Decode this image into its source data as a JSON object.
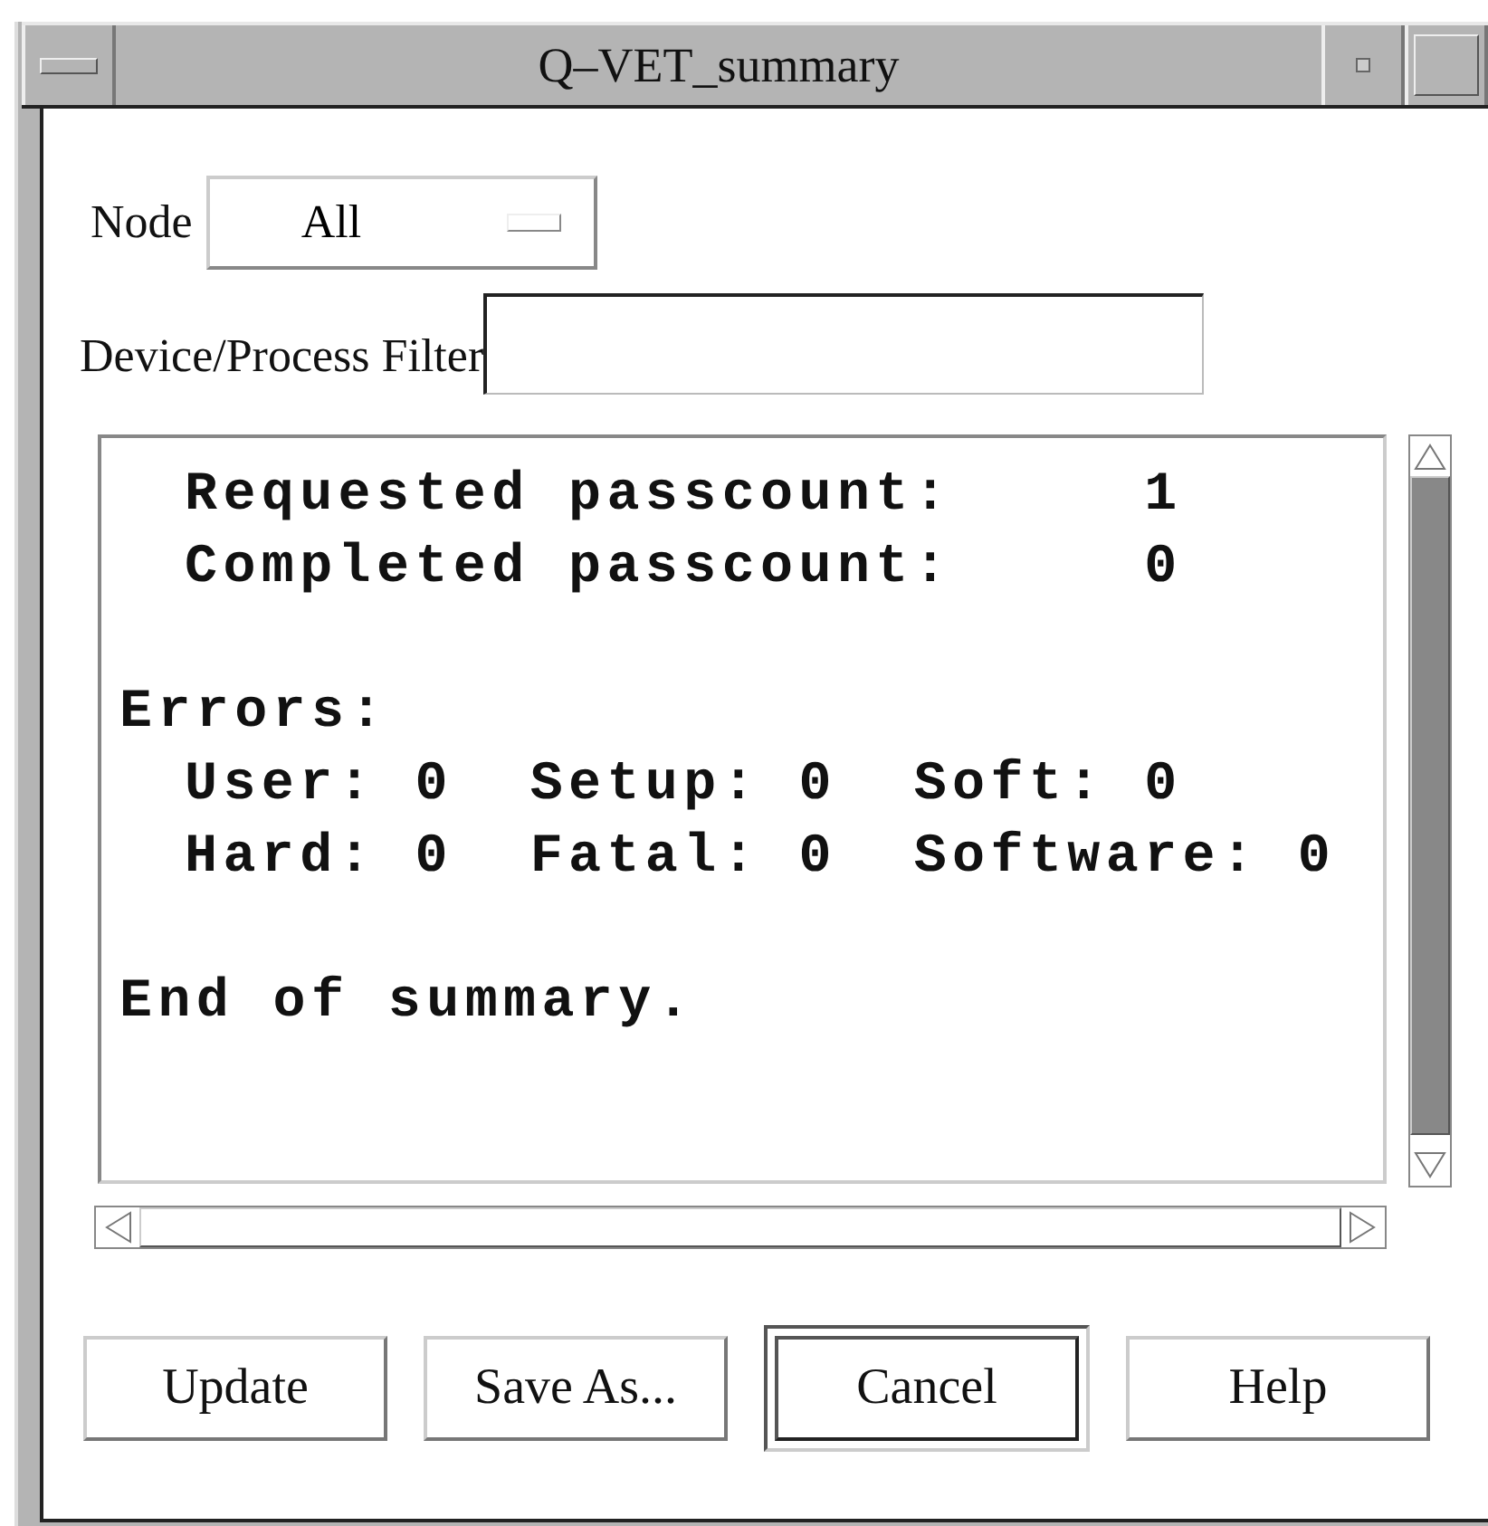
{
  "window": {
    "title": "Q–VET_summary"
  },
  "node": {
    "label": "Node",
    "value": "All"
  },
  "filter": {
    "label": "Device/Process Filter"
  },
  "summary": [
    {
      "kind": "item",
      "text": "Requested passcount:     1"
    },
    {
      "kind": "item",
      "text": "Completed passcount:     0"
    },
    {
      "kind": "blank"
    },
    {
      "kind": "heading",
      "text": "Errors:"
    },
    {
      "kind": "item",
      "text": "User: 0  Setup: 0  Soft: 0"
    },
    {
      "kind": "item",
      "text": "Hard: 0  Fatal: 0  Software: 0"
    },
    {
      "kind": "blank"
    },
    {
      "kind": "heading",
      "text": "End of summary."
    }
  ],
  "buttons": [
    {
      "label": "Update",
      "default": false
    },
    {
      "label": "Save As...",
      "default": false
    },
    {
      "label": "Cancel",
      "default": true
    },
    {
      "label": "Help",
      "default": false
    }
  ]
}
